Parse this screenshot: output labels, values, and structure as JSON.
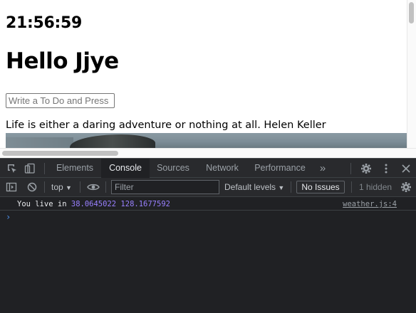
{
  "page": {
    "clock": "21:56:59",
    "greeting": "Hello Jjye",
    "todo_placeholder": "Write a To Do and Press",
    "quote": "Life is either a daring adventure or nothing at all. Helen Keller"
  },
  "devtools": {
    "tabs": [
      {
        "label": "Elements",
        "active": false
      },
      {
        "label": "Console",
        "active": true
      },
      {
        "label": "Sources",
        "active": false
      },
      {
        "label": "Network",
        "active": false
      },
      {
        "label": "Performance",
        "active": false
      }
    ],
    "more_tabs": "»",
    "icons": [
      "inspect-element-icon",
      "device-toggle-icon",
      "settings-gear-icon",
      "kebab-menu-icon",
      "close-icon"
    ],
    "toolbar": {
      "context": "top",
      "filter_placeholder": "Filter",
      "levels": "Default levels",
      "issues": "No Issues",
      "hidden": "1 hidden"
    },
    "console": {
      "message_prefix": "You live in",
      "lat": "38.0645022",
      "lng": "128.1677592",
      "source": "weather.js:4",
      "prompt": "›"
    }
  },
  "colors": {
    "devtools_bg": "#202124",
    "toolbar_bg": "#292a2d",
    "number_color": "#9980ff",
    "prompt_color": "#4d8fe8"
  }
}
